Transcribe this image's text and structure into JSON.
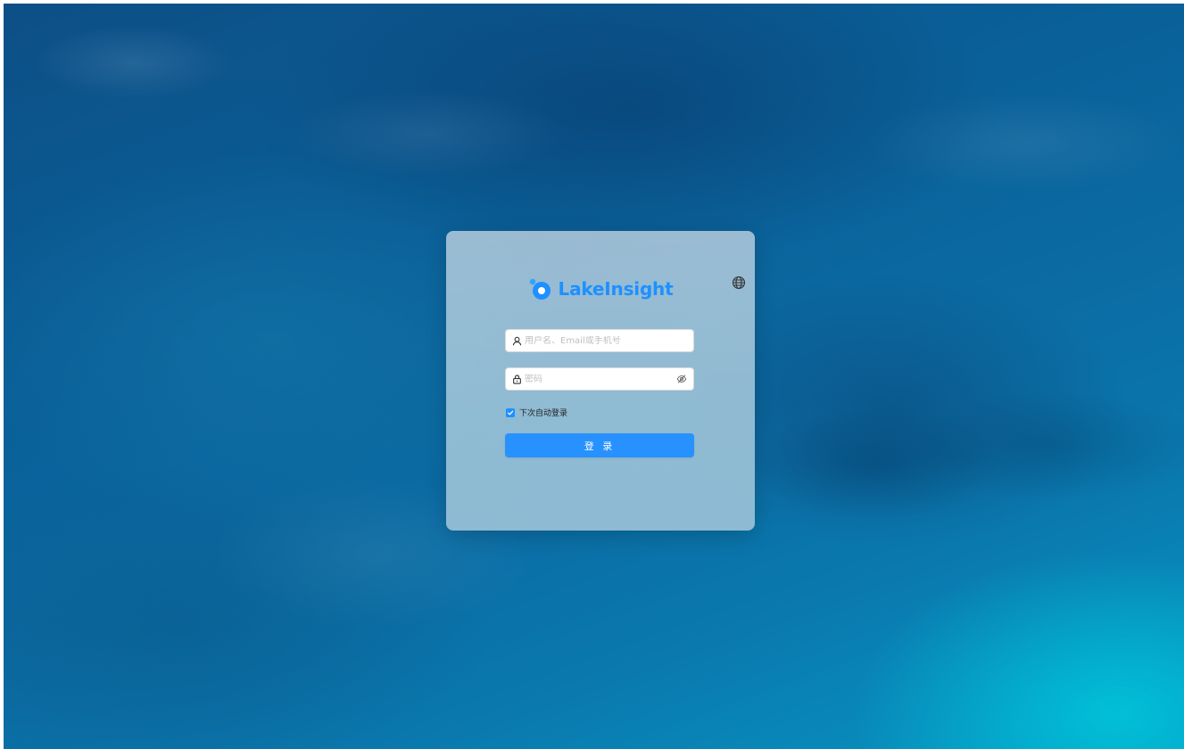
{
  "app": {
    "brand_name": "LakeInsight",
    "logo_icon": "lakeinsight-logo-icon",
    "accent_color": "#1e90ff"
  },
  "login_form": {
    "language_icon": "globe-icon",
    "username": {
      "icon": "user-icon",
      "value": "",
      "placeholder": "用户名、Email或手机号"
    },
    "password": {
      "icon": "lock-icon",
      "value": "",
      "placeholder": "密码",
      "visibility_icon": "eye-invisible-icon"
    },
    "remember_me": {
      "label": "下次自动登录",
      "checked": true
    },
    "submit_label": "登 录"
  }
}
